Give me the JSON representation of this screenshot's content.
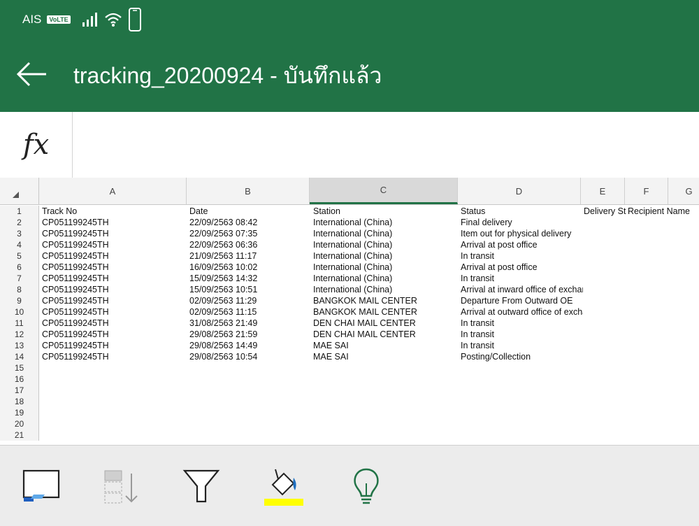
{
  "status_bar": {
    "carrier": "AIS",
    "volte": "VoLTE"
  },
  "header": {
    "title": "tracking_20200924 - บันทึกแล้ว"
  },
  "formula_bar": {
    "fx_label": "fx",
    "value": ""
  },
  "columns": [
    "A",
    "B",
    "C",
    "D",
    "E",
    "F",
    "G"
  ],
  "selected_column": "C",
  "row_numbers": [
    "1",
    "2",
    "3",
    "4",
    "5",
    "6",
    "7",
    "8",
    "9",
    "10",
    "11",
    "12",
    "13",
    "14",
    "15",
    "16",
    "17",
    "18",
    "19",
    "20",
    "21"
  ],
  "table": {
    "headers": [
      "Track No",
      "Date",
      "Station",
      "Status",
      "Delivery St",
      "Recipient Name"
    ],
    "rows": [
      [
        "CP051199245TH",
        "22/09/2563 08:42",
        "International (China)",
        "Final delivery"
      ],
      [
        "CP051199245TH",
        "22/09/2563 07:35",
        "International (China)",
        "Item out for physical delivery"
      ],
      [
        "CP051199245TH",
        "22/09/2563 06:36",
        "International (China)",
        "Arrival at post office"
      ],
      [
        "CP051199245TH",
        "21/09/2563 11:17",
        "International (China)",
        "In transit"
      ],
      [
        "CP051199245TH",
        "16/09/2563 10:02",
        "International (China)",
        "Arrival at post office"
      ],
      [
        "CP051199245TH",
        "15/09/2563 14:32",
        "International (China)",
        "In transit"
      ],
      [
        "CP051199245TH",
        "15/09/2563 10:51",
        "International (China)",
        "Arrival at inward office of exchange"
      ],
      [
        "CP051199245TH",
        "02/09/2563 11:29",
        "BANGKOK MAIL CENTER",
        "Departure From Outward OE"
      ],
      [
        "CP051199245TH",
        "02/09/2563 11:15",
        "BANGKOK MAIL CENTER",
        "Arrival at outward office of exchange"
      ],
      [
        "CP051199245TH",
        "31/08/2563 21:49",
        "DEN CHAI MAIL CENTER",
        "In transit"
      ],
      [
        "CP051199245TH",
        "29/08/2563 21:59",
        "DEN CHAI MAIL CENTER",
        "In transit"
      ],
      [
        "CP051199245TH",
        "29/08/2563 14:49",
        "MAE SAI",
        "In transit"
      ],
      [
        "CP051199245TH",
        "29/08/2563 10:54",
        "MAE SAI",
        "Posting/Collection"
      ]
    ]
  },
  "toolbar": {
    "items": [
      {
        "icon": "select-range-icon"
      },
      {
        "icon": "insert-row-icon"
      },
      {
        "icon": "filter-icon"
      },
      {
        "icon": "fill-color-icon",
        "accent": "#ffff00"
      },
      {
        "icon": "lightbulb-icon",
        "accent": "#217346"
      }
    ]
  },
  "colors": {
    "brand": "#217346",
    "fill_highlight": "#ffff00"
  }
}
